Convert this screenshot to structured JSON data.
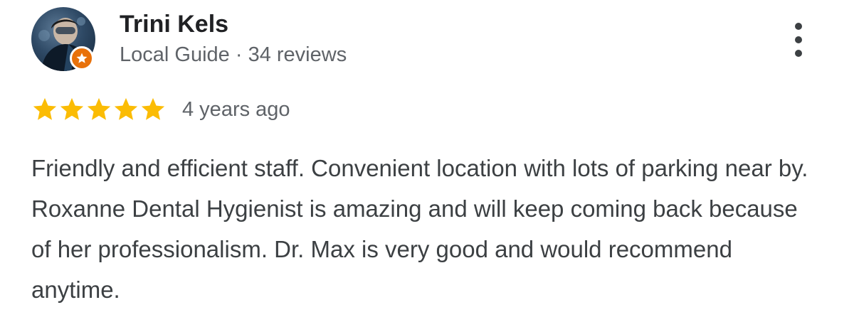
{
  "review": {
    "reviewer": {
      "name": "Trini Kels",
      "badge": "Local Guide",
      "separator": "·",
      "review_count": "34 reviews",
      "avatar_icon": "user-photo-avatar",
      "badge_icon": "local-guide-star-icon"
    },
    "menu_icon": "more-vert-icon",
    "rating": {
      "stars": 5,
      "max_stars": 5,
      "star_color": "#fbbc04",
      "time_ago": "4 years ago"
    },
    "text": "Friendly and efficient staff. Convenient location with lots of parking near by. Roxanne Dental Hygienist is amazing and will keep coming back because of her professionalism. Dr. Max is very good and would recommend anytime."
  }
}
